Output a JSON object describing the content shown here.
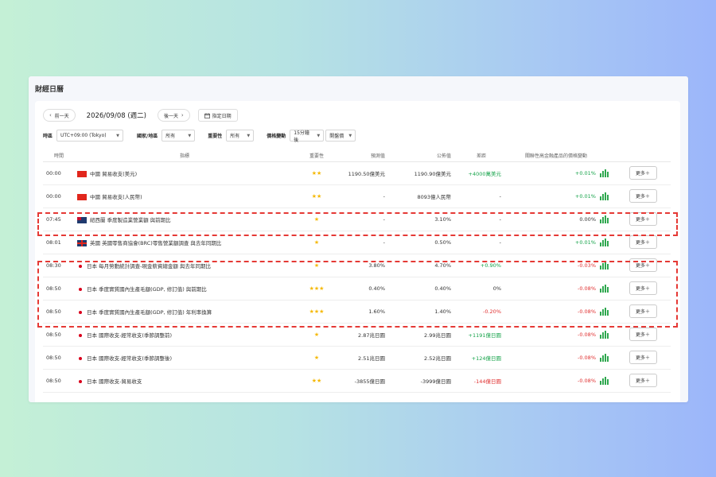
{
  "title": "財經日曆",
  "nav": {
    "prev_label": "前一天",
    "date": "2026/09/08 (週二)",
    "next_label": "後一天",
    "pick_label": "指定日期"
  },
  "filters": {
    "timezone_label": "時區",
    "timezone_value": "UTC+09:00 (Tokyo)",
    "region_label": "國家/地區",
    "region_value": "所有",
    "importance_label": "重要性",
    "importance_value": "所有",
    "price_label": "價格變動",
    "price_value": "15分鐘後",
    "price_type_value": "開盤價"
  },
  "table": {
    "headers": [
      "時間",
      "指標",
      "重要性",
      "預測值",
      "公佈值",
      "差距",
      "關聯性高金融產品的價格變動"
    ],
    "more_label": "更多＋",
    "rows": [
      {
        "time": "00:00",
        "flag": "cn",
        "indicator": "中國 貿易收支(美元)",
        "stars": "★★",
        "forecast": "1190.50億美元",
        "actual": "1190.90億美元",
        "diff": "+4000萬美元",
        "diff_class": "pos",
        "change": "+0.01%",
        "change_class": "pos"
      },
      {
        "time": "00:00",
        "flag": "cn",
        "indicator": "中國 貿易收支(人民幣)",
        "stars": "★★",
        "forecast": "-",
        "actual": "8093億人民幣",
        "diff": "-",
        "diff_class": "",
        "change": "+0.01%",
        "change_class": "pos"
      },
      {
        "time": "07:45",
        "flag": "nz",
        "indicator": "紐西蘭 季度製造業營業額 與前期比",
        "stars": "★",
        "forecast": "-",
        "actual": "3.10%",
        "diff": "-",
        "diff_class": "",
        "change": "0.00%",
        "change_class": ""
      },
      {
        "time": "08:01",
        "flag": "uk",
        "indicator": "英國 英國零售商協會(BRC)零售營業額調查 與去年同期比",
        "stars": "★",
        "forecast": "-",
        "actual": "0.50%",
        "diff": "-",
        "diff_class": "",
        "change": "+0.01%",
        "change_class": "pos"
      },
      {
        "time": "08:30",
        "flag": "jp",
        "indicator": "日本 每月勞動統計調查-現金薪資總金額 與去年同期比",
        "stars": "★",
        "forecast": "3.80%",
        "actual": "4.70%",
        "diff": "+0.90%",
        "diff_class": "pos",
        "change": "-0.03%",
        "change_class": "neg"
      },
      {
        "time": "08:50",
        "flag": "jp",
        "indicator": "日本 季度實質國內生產毛額(GDP, 修訂值) 與前期比",
        "stars": "★★★",
        "forecast": "0.40%",
        "actual": "0.40%",
        "diff": "0%",
        "diff_class": "",
        "change": "-0.08%",
        "change_class": "neg"
      },
      {
        "time": "08:50",
        "flag": "jp",
        "indicator": "日本 季度實質國內生產毛額(GDP, 修訂值) 年利率換算",
        "stars": "★★★",
        "forecast": "1.60%",
        "actual": "1.40%",
        "diff": "-0.20%",
        "diff_class": "neg",
        "change": "-0.08%",
        "change_class": "neg"
      },
      {
        "time": "08:50",
        "flag": "jp",
        "indicator": "日本 國際收支-經常收支(季節調整前)",
        "stars": "★",
        "forecast": "2.87兆日圓",
        "actual": "2.99兆日圓",
        "diff": "+1191億日圓",
        "diff_class": "pos",
        "change": "-0.08%",
        "change_class": "neg"
      },
      {
        "time": "08:50",
        "flag": "jp",
        "indicator": "日本 國際收支-經常收支(季節調整後)",
        "stars": "★",
        "forecast": "2.51兆日圓",
        "actual": "2.52兆日圓",
        "diff": "+124億日圓",
        "diff_class": "pos",
        "change": "-0.08%",
        "change_class": "neg"
      },
      {
        "time": "08:50",
        "flag": "jp",
        "indicator": "日本 國際收支-貿易收支",
        "stars": "★★",
        "forecast": "-3855億日圓",
        "actual": "-3999億日圓",
        "diff": "-144億日圓",
        "diff_class": "neg",
        "change": "-0.08%",
        "change_class": "neg"
      }
    ]
  }
}
